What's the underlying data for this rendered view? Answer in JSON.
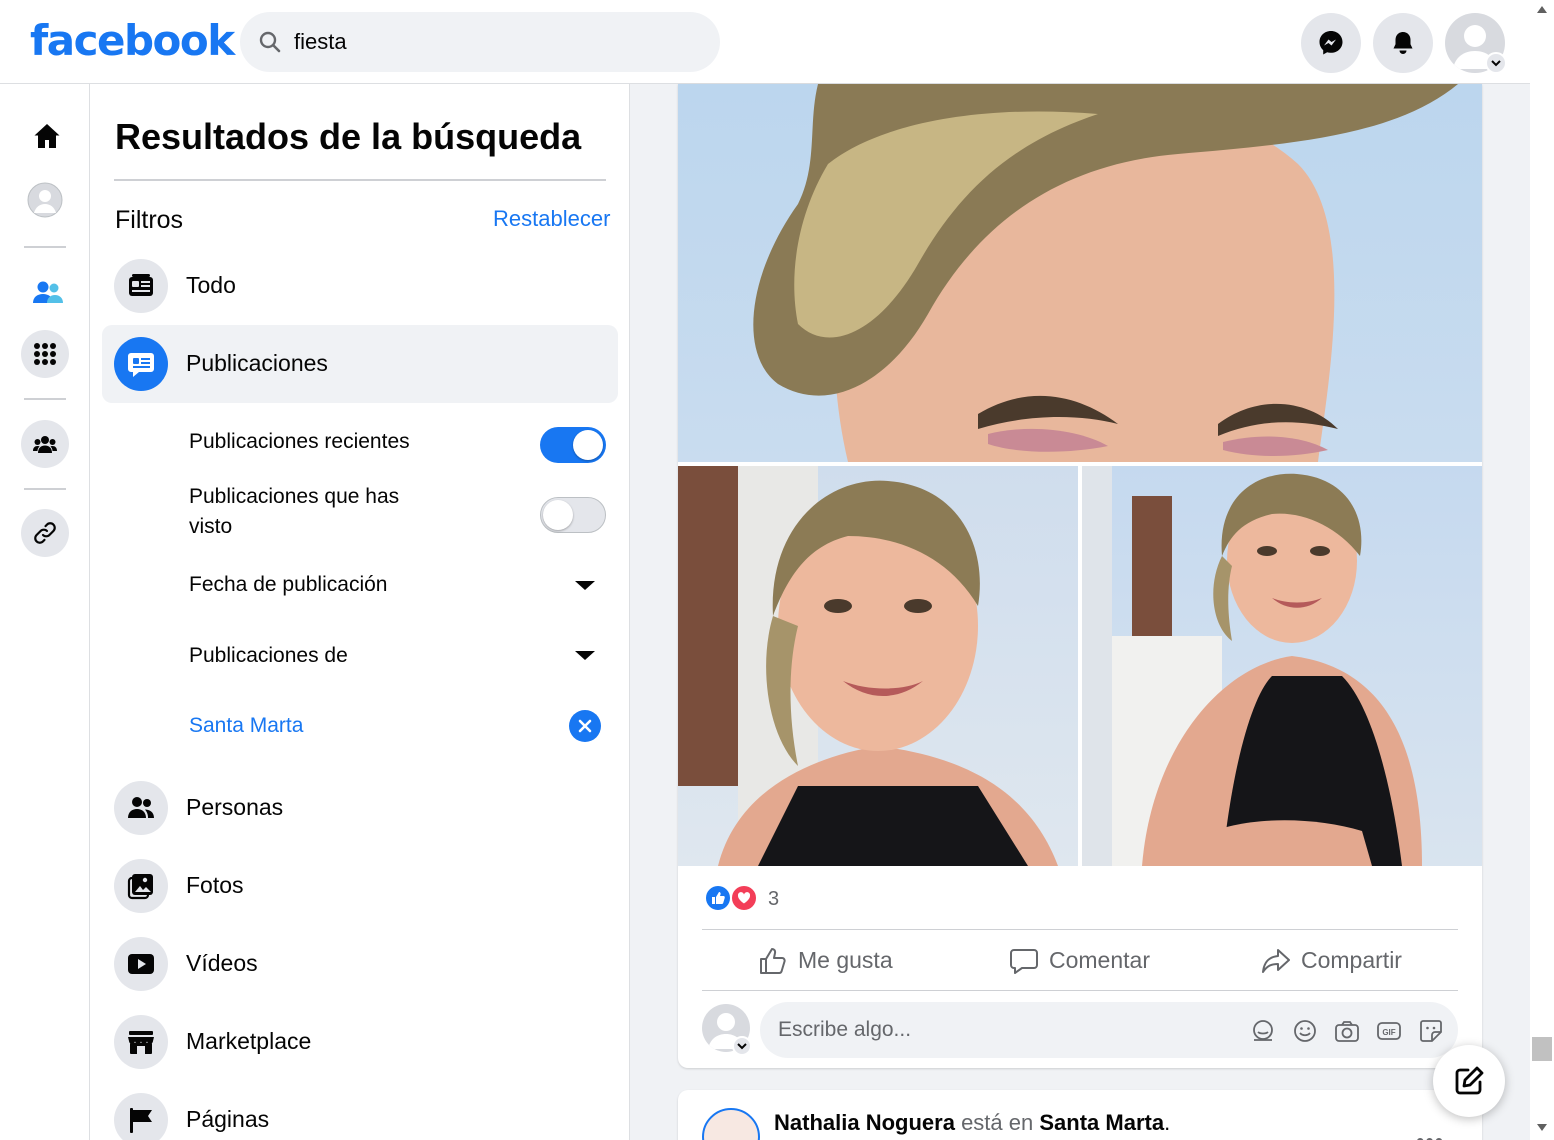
{
  "header": {
    "logo": "facebook",
    "search_value": "fiesta"
  },
  "panel": {
    "title": "Resultados de la búsqueda",
    "filters_label": "Filtros",
    "reset_label": "Restablecer",
    "items": [
      {
        "label": "Todo",
        "icon": "feed-icon"
      },
      {
        "label": "Publicaciones",
        "icon": "posts-icon",
        "active": true
      },
      {
        "label": "Personas",
        "icon": "people-icon"
      },
      {
        "label": "Fotos",
        "icon": "photos-icon"
      },
      {
        "label": "Vídeos",
        "icon": "video-icon"
      },
      {
        "label": "Marketplace",
        "icon": "marketplace-icon"
      },
      {
        "label": "Páginas",
        "icon": "flag-icon"
      }
    ],
    "sub_filters": {
      "recent_posts": {
        "label": "Publicaciones recientes",
        "enabled": true
      },
      "seen_posts": {
        "label_line1": "Publicaciones que has",
        "label_line2": "visto",
        "enabled": false
      },
      "post_date": {
        "label": "Fecha de publicación"
      },
      "posts_from": {
        "label": "Publicaciones de"
      },
      "location": {
        "label": "Santa Marta"
      }
    }
  },
  "post": {
    "reaction_count": "3",
    "actions": {
      "like": "Me gusta",
      "comment": "Comentar",
      "share": "Compartir"
    },
    "comment_placeholder": "Escribe algo..."
  },
  "next_post": {
    "author": "Nathalia Noguera",
    "connector": "está en",
    "place": "Santa Marta",
    "period": ".",
    "more": "•••"
  },
  "colors": {
    "brand": "#1877f2",
    "love": "#f33e58",
    "background": "#f0f2f5"
  }
}
